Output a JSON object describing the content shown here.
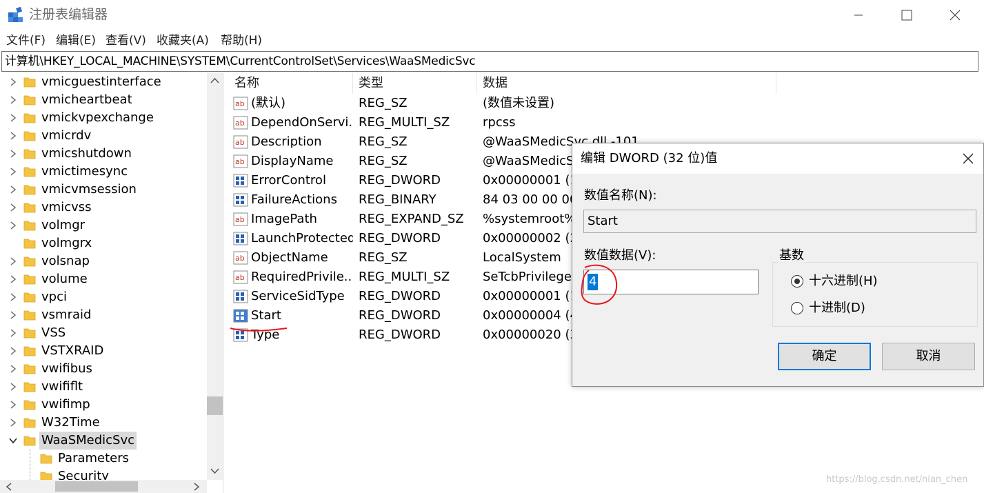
{
  "window": {
    "title": "注册表编辑器",
    "icon": "registry-editor-icon"
  },
  "menu": [
    "文件(F)",
    "编辑(E)",
    "查看(V)",
    "收藏夹(A)",
    "帮助(H)"
  ],
  "address": "计算机\\HKEY_LOCAL_MACHINE\\SYSTEM\\CurrentControlSet\\Services\\WaaSMedicSvc",
  "tree": {
    "items": [
      {
        "label": "vmicguestinterface",
        "expander": "collapsed",
        "indent": 0
      },
      {
        "label": "vmicheartbeat",
        "expander": "collapsed",
        "indent": 0
      },
      {
        "label": "vmickvpexchange",
        "expander": "collapsed",
        "indent": 0
      },
      {
        "label": "vmicrdv",
        "expander": "collapsed",
        "indent": 0
      },
      {
        "label": "vmicshutdown",
        "expander": "collapsed",
        "indent": 0
      },
      {
        "label": "vmictimesync",
        "expander": "collapsed",
        "indent": 0
      },
      {
        "label": "vmicvmsession",
        "expander": "collapsed",
        "indent": 0
      },
      {
        "label": "vmicvss",
        "expander": "collapsed",
        "indent": 0
      },
      {
        "label": "volmgr",
        "expander": "collapsed",
        "indent": 0
      },
      {
        "label": "volmgrx",
        "expander": "none",
        "indent": 0
      },
      {
        "label": "volsnap",
        "expander": "collapsed",
        "indent": 0
      },
      {
        "label": "volume",
        "expander": "collapsed",
        "indent": 0
      },
      {
        "label": "vpci",
        "expander": "collapsed",
        "indent": 0
      },
      {
        "label": "vsmraid",
        "expander": "collapsed",
        "indent": 0
      },
      {
        "label": "VSS",
        "expander": "collapsed",
        "indent": 0
      },
      {
        "label": "VSTXRAID",
        "expander": "collapsed",
        "indent": 0
      },
      {
        "label": "vwifibus",
        "expander": "collapsed",
        "indent": 0
      },
      {
        "label": "vwififlt",
        "expander": "collapsed",
        "indent": 0
      },
      {
        "label": "vwifimp",
        "expander": "collapsed",
        "indent": 0
      },
      {
        "label": "W32Time",
        "expander": "collapsed",
        "indent": 0
      },
      {
        "label": "WaaSMedicSvc",
        "expander": "expanded",
        "indent": 0,
        "selected": true
      },
      {
        "label": "Parameters",
        "expander": "none",
        "indent": 1
      },
      {
        "label": "Security",
        "expander": "none",
        "indent": 1
      }
    ]
  },
  "list": {
    "columns": [
      "名称",
      "类型",
      "数据"
    ],
    "rows": [
      {
        "name": "(默认)",
        "type": "REG_SZ",
        "data": "(数值未设置)",
        "icon": "string-value-icon"
      },
      {
        "name": "DependOnServi...",
        "type": "REG_MULTI_SZ",
        "data": "rpcss",
        "icon": "string-value-icon"
      },
      {
        "name": "Description",
        "type": "REG_SZ",
        "data": "@WaaSMedicSvc.dll,-101",
        "icon": "string-value-icon"
      },
      {
        "name": "DisplayName",
        "type": "REG_SZ",
        "data": "@WaaSMedicS",
        "icon": "string-value-icon"
      },
      {
        "name": "ErrorControl",
        "type": "REG_DWORD",
        "data": "0x00000001 (1",
        "icon": "binary-value-icon"
      },
      {
        "name": "FailureActions",
        "type": "REG_BINARY",
        "data": "84 03 00 00 00",
        "icon": "binary-value-icon"
      },
      {
        "name": "ImagePath",
        "type": "REG_EXPAND_SZ",
        "data": "%systemroot%",
        "icon": "string-value-icon"
      },
      {
        "name": "LaunchProtected",
        "type": "REG_DWORD",
        "data": "0x00000002 (2",
        "icon": "binary-value-icon"
      },
      {
        "name": "ObjectName",
        "type": "REG_SZ",
        "data": "LocalSystem",
        "icon": "string-value-icon"
      },
      {
        "name": "RequiredPrivile...",
        "type": "REG_MULTI_SZ",
        "data": "SeTcbPrivilege",
        "icon": "string-value-icon"
      },
      {
        "name": "ServiceSidType",
        "type": "REG_DWORD",
        "data": "0x00000001 (1",
        "icon": "binary-value-icon"
      },
      {
        "name": "Start",
        "type": "REG_DWORD",
        "data": "0x00000004 (4",
        "icon": "binary-value-icon",
        "selected": true
      },
      {
        "name": "Type",
        "type": "REG_DWORD",
        "data": "0x00000020 (3",
        "icon": "binary-value-icon"
      }
    ]
  },
  "dialog": {
    "title": "编辑 DWORD (32 位)值",
    "name_label": "数值名称(N):",
    "name_value": "Start",
    "data_label": "数值数据(V):",
    "data_value": "4",
    "base_label": "基数",
    "options": [
      {
        "label": "十六进制(H)",
        "checked": true
      },
      {
        "label": "十进制(D)",
        "checked": false
      }
    ],
    "ok_label": "确定",
    "cancel_label": "取消"
  },
  "watermark": "https://blog.csdn.net/nian_chen",
  "colors": {
    "selection": "#d9d9d9",
    "accent": "#0078d7",
    "annotation": "#e8141a",
    "folder": "#f5c342"
  }
}
